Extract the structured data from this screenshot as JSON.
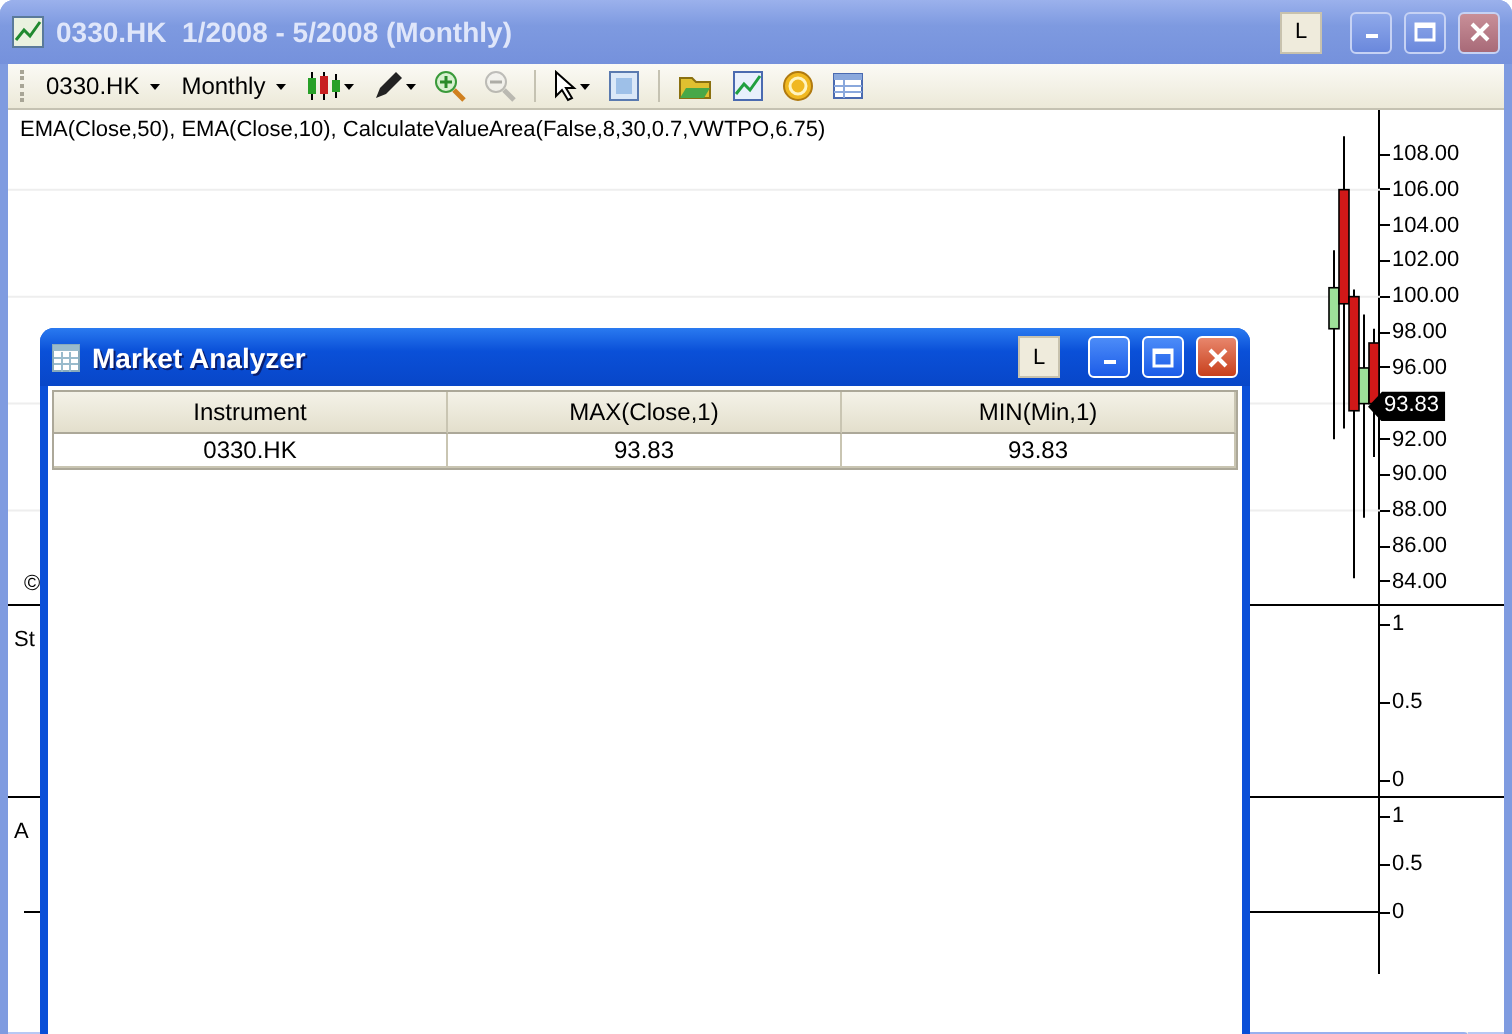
{
  "chart_window": {
    "title": "0330.HK  1/2008 - 5/2008 (Monthly)",
    "active": false,
    "layout_button": "L",
    "toolbar": {
      "instrument": "0330.HK",
      "interval": "Monthly",
      "tool_groups": [
        [
          {
            "kind": "candles",
            "menu": true,
            "disabled": false
          },
          {
            "kind": "pencil",
            "menu": true,
            "disabled": false
          },
          {
            "kind": "zoom-in",
            "menu": false,
            "disabled": false
          },
          {
            "kind": "zoom-out",
            "menu": false,
            "disabled": true
          }
        ],
        [
          {
            "kind": "pointer",
            "menu": true,
            "disabled": false
          },
          {
            "kind": "data-box",
            "menu": false,
            "disabled": false
          }
        ],
        [
          {
            "kind": "folder",
            "menu": false,
            "disabled": false
          },
          {
            "kind": "chart",
            "menu": false,
            "disabled": false
          },
          {
            "kind": "coin",
            "menu": false,
            "disabled": false
          },
          {
            "kind": "table",
            "menu": false,
            "disabled": false
          }
        ]
      ]
    },
    "indicator_label": "EMA(Close,50), EMA(Close,10), CalculateValueArea(False,8,30,0.7,VWTPO,6.75)",
    "panels": [
      {
        "kind": "price",
        "label": "©",
        "axis_labels": [
          "108.00",
          "106.00",
          "104.00",
          "102.00",
          "100.00",
          "98.00",
          "96.00",
          "92.00",
          "90.00",
          "88.00",
          "86.00",
          "84.00"
        ],
        "price_marker": "93.83"
      },
      {
        "kind": "indicator",
        "label": "St",
        "axis_labels": [
          "1",
          "0.5",
          "0"
        ]
      },
      {
        "kind": "indicator",
        "label": "A",
        "axis_labels": [
          "1",
          "0.5",
          "0"
        ]
      }
    ]
  },
  "market_analyzer": {
    "title": "Market Analyzer",
    "active": true,
    "layout_button": "L",
    "columns": [
      "Instrument",
      "MAX(Close,1)",
      "MIN(Min,1)"
    ],
    "rows": [
      {
        "cells": [
          "0330.HK",
          "93.83",
          "93.83"
        ]
      }
    ]
  }
}
